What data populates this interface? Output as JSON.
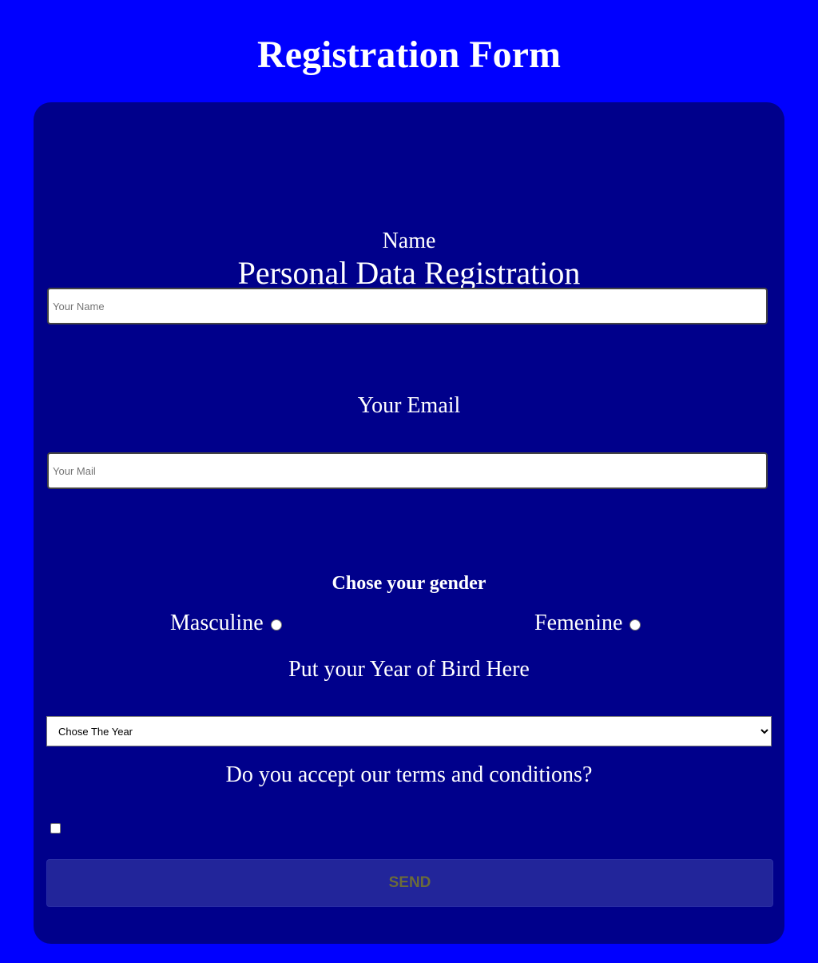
{
  "header": {
    "title": "Registration Form"
  },
  "form": {
    "title": "Personal Data Registration",
    "name_label": "Name",
    "name_placeholder": "Your Name",
    "email_label": "Your Email",
    "email_placeholder": "Your Mail",
    "gender_label": "Chose your gender",
    "gender_options": [
      "Masculine",
      "Femenine"
    ],
    "year_label": "Put your Year of Bird Here",
    "year_selected": "Chose The Year",
    "terms_label": "Do you accept our terms and conditions?",
    "terms_checked": false,
    "send_label": "SEND"
  }
}
